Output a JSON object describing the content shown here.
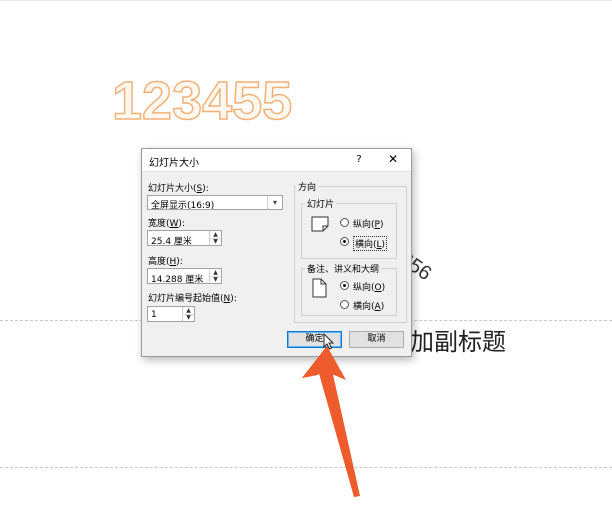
{
  "slide": {
    "big_number": "123455",
    "rotated_text": "656",
    "subtitle_fragment": "加副标题"
  },
  "dialog": {
    "title": "幻灯片大小",
    "help": "?",
    "close": "✕",
    "size_label_pre": "幻灯片大小(",
    "size_label_key": "S",
    "size_label_post": "):",
    "size_value": "全屏显示(16:9)",
    "width_label_pre": "宽度(",
    "width_label_key": "W",
    "width_label_post": "):",
    "width_value": "25.4 厘米",
    "height_label_pre": "高度(",
    "height_label_key": "H",
    "height_label_post": "):",
    "height_value": "14.288 厘米",
    "start_label_pre": "幻灯片编号起始值(",
    "start_label_key": "N",
    "start_label_post": "):",
    "start_value": "1",
    "orientation_label": "方向",
    "slides_group": "幻灯片",
    "slides_portrait_pre": "纵向(",
    "slides_portrait_key": "P",
    "slides_landscape_pre": "横向(",
    "slides_landscape_key": "L",
    "notes_group": "备注、讲义和大纲",
    "notes_portrait_pre": "纵向(",
    "notes_portrait_key": "O",
    "notes_landscape_pre": "横向(",
    "notes_landscape_key": "A",
    "paren_close": ")",
    "ok": "确定",
    "cancel": "取消"
  },
  "colors": {
    "arrow": "#ee5b2c",
    "number_outline": "#f0b27a",
    "focus_blue": "#0078d7"
  }
}
